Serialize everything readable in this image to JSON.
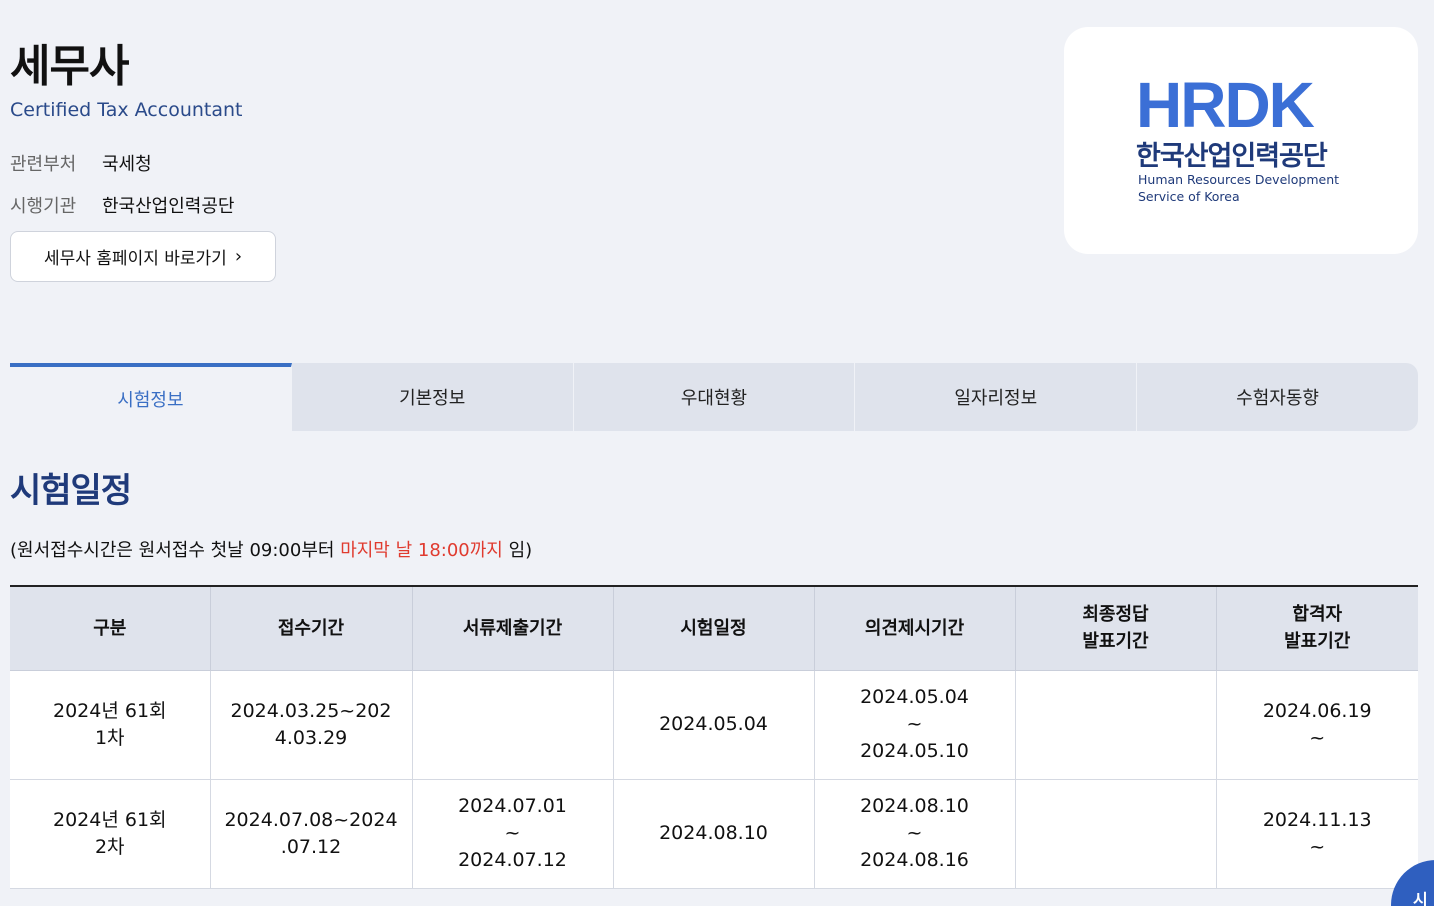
{
  "header": {
    "title": "세무사",
    "subtitle": "Certified Tax Accountant",
    "info": [
      {
        "label": "관련부처",
        "value": "국세청"
      },
      {
        "label": "시행기관",
        "value": "한국산업인력공단"
      }
    ],
    "home_button": "세무사 홈페이지 바로가기",
    "chevron": "›"
  },
  "logo": {
    "wordmark": "HRDK",
    "korean": "한국산업인력공단",
    "english_line1": "Human Resources Development",
    "english_line2": "Service of Korea",
    "colors": {
      "blue": "#3b6fd6",
      "navy": "#1f3a7a"
    }
  },
  "tabs": [
    {
      "label": "시험정보",
      "active": true
    },
    {
      "label": "기본정보",
      "active": false
    },
    {
      "label": "우대현황",
      "active": false
    },
    {
      "label": "일자리정보",
      "active": false
    },
    {
      "label": "수험자동향",
      "active": false
    }
  ],
  "section": {
    "title": "시험일정",
    "notice_prefix": "(원서접수시간은 원서접수 첫날 09:00부터 ",
    "notice_highlight": "마지막 날 18:00까지",
    "notice_suffix": " 임)"
  },
  "table": {
    "headers": [
      [
        "구분"
      ],
      [
        "접수기간"
      ],
      [
        "서류제출기간"
      ],
      [
        "시험일정"
      ],
      [
        "의견제시기간"
      ],
      [
        "최종정답",
        "발표기간"
      ],
      [
        "합격자",
        "발표기간"
      ]
    ],
    "rows": [
      [
        [
          "2024년 61회",
          "1차"
        ],
        [
          "2024.03.25~202",
          "4.03.29"
        ],
        [],
        [
          "2024.05.04"
        ],
        [
          "2024.05.04",
          "~",
          "2024.05.10"
        ],
        [],
        [
          "2024.06.19",
          "~"
        ]
      ],
      [
        [
          "2024년 61회",
          "2차"
        ],
        [
          "2024.07.08~2024",
          ".07.12"
        ],
        [
          "2024.07.01",
          "~",
          "2024.07.12"
        ],
        [
          "2024.08.10"
        ],
        [
          "2024.08.10",
          "~",
          "2024.08.16"
        ],
        [],
        [
          "2024.11.13",
          "~"
        ]
      ]
    ]
  },
  "float_button": {
    "label": "시"
  },
  "colors": {
    "accent": "#3a6fc4",
    "title_navy": "#1f3a7a",
    "highlight_red": "#e03b2f"
  }
}
